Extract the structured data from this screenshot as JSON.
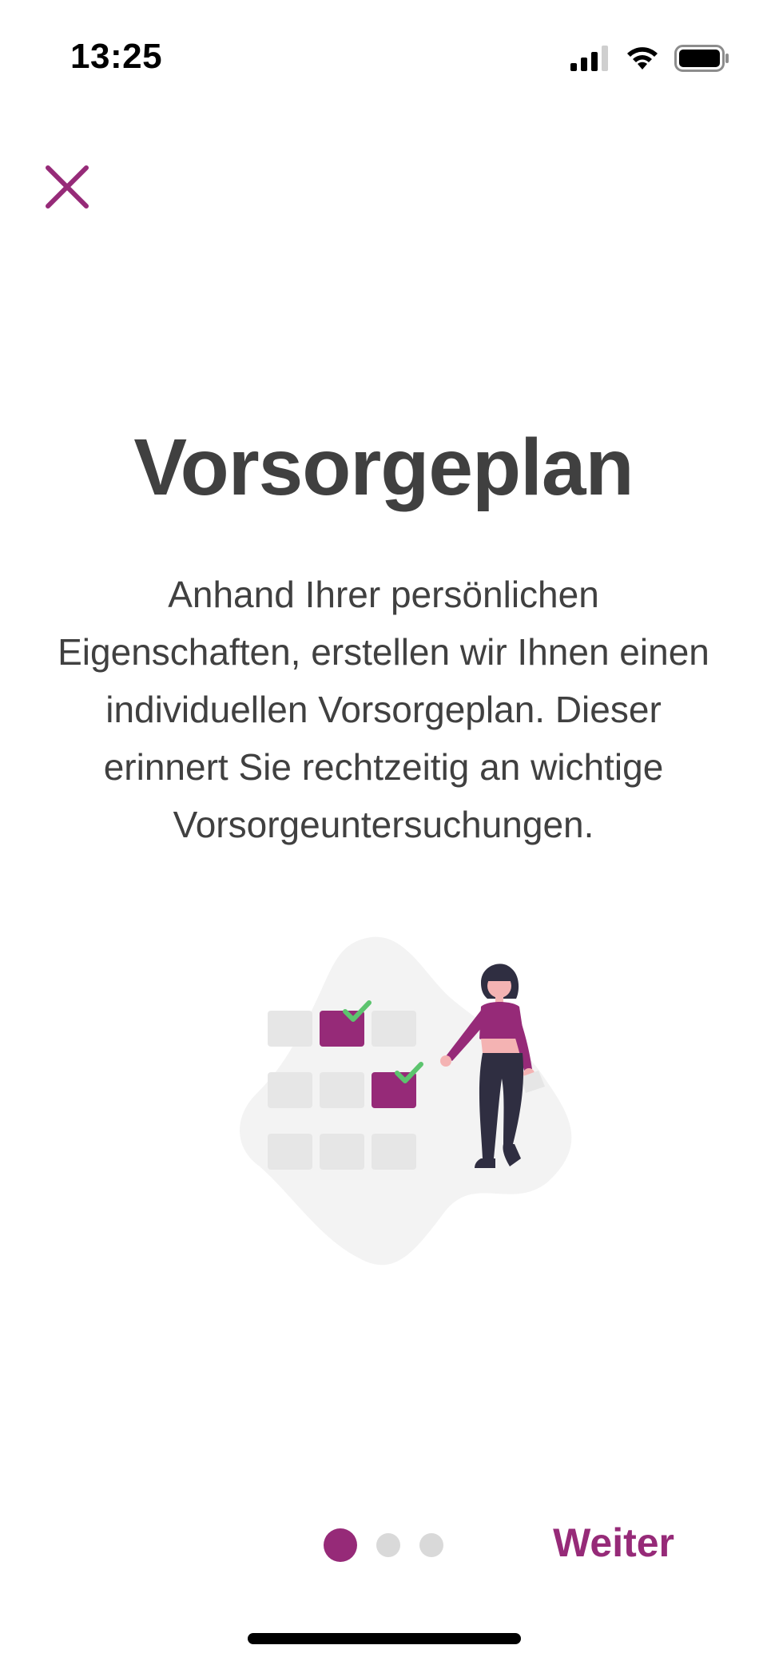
{
  "status_bar": {
    "time": "13:25",
    "icons": [
      "signal-icon",
      "wifi-icon",
      "battery-icon"
    ]
  },
  "close_icon": "close-icon",
  "title": "Vorsorgeplan",
  "description": "Anhand Ihrer persönlichen Eigenschaften, erstellen wir Ihnen einen individuellen Vorsorgeplan. Dieser erinnert Sie rechtzeitig an wichtige Vorsorgeuntersuchungen.",
  "pager": {
    "total": 3,
    "current": 1
  },
  "next_label": "Weiter",
  "colors": {
    "accent": "#962a78",
    "text": "#404040",
    "check": "#5cc46e",
    "inactive_dot": "#d9d9d9"
  }
}
